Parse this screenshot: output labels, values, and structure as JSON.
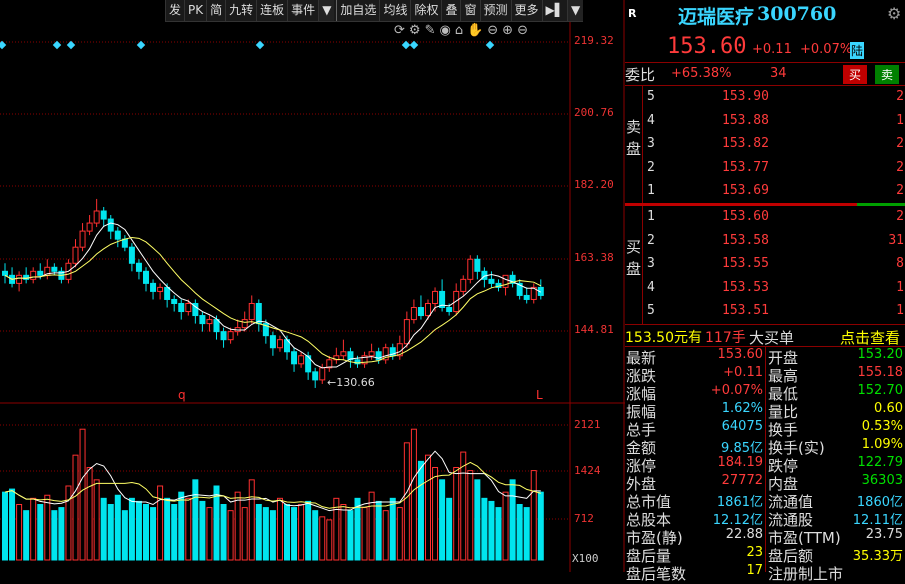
{
  "toolbar": {
    "items": [
      "发",
      "PK",
      "简",
      "九转",
      "连板",
      "事件",
      "▼",
      "加自选",
      "均线",
      "除权",
      "叠",
      "窗",
      "预测",
      "更多",
      "▶▌",
      "▼"
    ]
  },
  "chart": {
    "price_axis": [
      "219.32",
      "200.76",
      "182.20",
      "163.38",
      "144.81"
    ],
    "volume_axis": [
      "2121",
      "1424",
      "712",
      "X100"
    ],
    "low_marker": "←130.66",
    "marker_q": "q",
    "marker_l": "L",
    "colors": {
      "up": "#ff3030",
      "down": "#00e5ee",
      "ma5": "#ffffff",
      "ma10": "#ffff66",
      "grid": "#8b0000"
    }
  },
  "chart_data": {
    "type": "candlestick",
    "ylim": [
      128,
      222
    ],
    "candles": [
      [
        160,
        159,
        162,
        157
      ],
      [
        159,
        157,
        161,
        156
      ],
      [
        157,
        159,
        160,
        155
      ],
      [
        159,
        158,
        161,
        157
      ],
      [
        158,
        160,
        161,
        157
      ],
      [
        160,
        159,
        162,
        158
      ],
      [
        159,
        161,
        163,
        158
      ],
      [
        161,
        160,
        162,
        159
      ],
      [
        160,
        158,
        161,
        157
      ],
      [
        158,
        162,
        163,
        157
      ],
      [
        162,
        166,
        168,
        161
      ],
      [
        166,
        170,
        172,
        165
      ],
      [
        170,
        172,
        174,
        169
      ],
      [
        172,
        175,
        178,
        171
      ],
      [
        175,
        173,
        176,
        171
      ],
      [
        173,
        170,
        174,
        168
      ],
      [
        170,
        168,
        171,
        166
      ],
      [
        168,
        166,
        169,
        165
      ],
      [
        166,
        162,
        167,
        160
      ],
      [
        162,
        160,
        163,
        158
      ],
      [
        160,
        157,
        161,
        155
      ],
      [
        157,
        155,
        158,
        153
      ],
      [
        155,
        156,
        157,
        153
      ],
      [
        156,
        153,
        157,
        151
      ],
      [
        153,
        152,
        154,
        150
      ],
      [
        152,
        150,
        153,
        148
      ],
      [
        150,
        152,
        153,
        149
      ],
      [
        152,
        149,
        153,
        147
      ],
      [
        149,
        147,
        150,
        145
      ],
      [
        147,
        148,
        149,
        145
      ],
      [
        148,
        145,
        149,
        143
      ],
      [
        145,
        143,
        146,
        141
      ],
      [
        143,
        145,
        146,
        142
      ],
      [
        145,
        146,
        148,
        144
      ],
      [
        146,
        148,
        150,
        145
      ],
      [
        148,
        152,
        154,
        147
      ],
      [
        152,
        147,
        153,
        145
      ],
      [
        147,
        144,
        148,
        142
      ],
      [
        144,
        141,
        145,
        139
      ],
      [
        141,
        143,
        144,
        140
      ],
      [
        143,
        140,
        144,
        138
      ],
      [
        140,
        137,
        141,
        135
      ],
      [
        137,
        139,
        140,
        136
      ],
      [
        139,
        135,
        140,
        133
      ],
      [
        135,
        133,
        136,
        131
      ],
      [
        133,
        136,
        137,
        132
      ],
      [
        136,
        138,
        139,
        135
      ],
      [
        138,
        139,
        141,
        137
      ],
      [
        139,
        140,
        143,
        138
      ],
      [
        140,
        138,
        141,
        136
      ],
      [
        138,
        137,
        139,
        136
      ],
      [
        137,
        139,
        140,
        136
      ],
      [
        139,
        140,
        142,
        138
      ],
      [
        140,
        138,
        141,
        137
      ],
      [
        138,
        141,
        142,
        137
      ],
      [
        141,
        139,
        142,
        138
      ],
      [
        139,
        142,
        144,
        138
      ],
      [
        142,
        148,
        150,
        141
      ],
      [
        148,
        151,
        153,
        147
      ],
      [
        151,
        149,
        154,
        148
      ],
      [
        149,
        152,
        153,
        148
      ],
      [
        152,
        155,
        156,
        150
      ],
      [
        155,
        151,
        158,
        150
      ],
      [
        151,
        150,
        152,
        149
      ],
      [
        150,
        155,
        157,
        149
      ],
      [
        155,
        158,
        159,
        154
      ],
      [
        158,
        163,
        164,
        157
      ],
      [
        163,
        160,
        164,
        158
      ],
      [
        160,
        158,
        161,
        156
      ],
      [
        158,
        157,
        160,
        156
      ],
      [
        157,
        156,
        158,
        155
      ],
      [
        156,
        159,
        159,
        154
      ],
      [
        159,
        157,
        160,
        156
      ],
      [
        157,
        154,
        158,
        153
      ],
      [
        154,
        153,
        156,
        152
      ],
      [
        153,
        156,
        157,
        152
      ],
      [
        156,
        154,
        158,
        153
      ]
    ],
    "volumes": [
      1100,
      1150,
      900,
      800,
      1000,
      900,
      1050,
      800,
      850,
      1200,
      1700,
      2121,
      1500,
      1300,
      1000,
      900,
      1050,
      800,
      1000,
      950,
      900,
      850,
      1200,
      1000,
      900,
      1100,
      1000,
      1300,
      950,
      850,
      1200,
      900,
      800,
      1100,
      850,
      1300,
      900,
      850,
      800,
      1000,
      900,
      850,
      900,
      950,
      800,
      700,
      650,
      1000,
      900,
      800,
      1000,
      850,
      1100,
      950,
      800,
      1000,
      850,
      1900,
      2121,
      1600,
      1700,
      1500,
      1300,
      1000,
      1500,
      1750,
      1450,
      1300,
      1000,
      950,
      850,
      1100,
      1300,
      900,
      850,
      1450,
      1100
    ]
  },
  "panel": {
    "logo": "R",
    "name": "迈瑞医疗",
    "code": "300760",
    "price": "153.60",
    "change": "+0.11",
    "change_pct": "+0.07%",
    "tag": "陆",
    "weibi_label": "委比",
    "weibi_value": "+65.38%",
    "weicha_value": "34",
    "buy_btn": "买",
    "sell_btn": "卖",
    "sell_label": [
      "卖",
      "盘"
    ],
    "buy_label": [
      "买",
      "盘"
    ],
    "sell_rows": [
      {
        "lvl": "5",
        "price": "153.90",
        "vol": "2"
      },
      {
        "lvl": "4",
        "price": "153.88",
        "vol": "1"
      },
      {
        "lvl": "3",
        "price": "153.82",
        "vol": "2"
      },
      {
        "lvl": "2",
        "price": "153.77",
        "vol": "2"
      },
      {
        "lvl": "1",
        "price": "153.69",
        "vol": "2"
      }
    ],
    "buy_rows": [
      {
        "lvl": "1",
        "price": "153.60",
        "vol": "2"
      },
      {
        "lvl": "2",
        "price": "153.58",
        "vol": "31"
      },
      {
        "lvl": "3",
        "price": "153.55",
        "vol": "8"
      },
      {
        "lvl": "4",
        "price": "153.53",
        "vol": "1"
      },
      {
        "lvl": "5",
        "price": "153.51",
        "vol": "1"
      }
    ],
    "bigorder_price": "153.50元有",
    "bigorder_vol": "117手",
    "bigorder_type": "大买单",
    "bigorder_link": "点击查看",
    "stats": [
      {
        "l1": "最新",
        "v1": "153.60",
        "c1": "red",
        "l2": "开盘",
        "v2": "153.20",
        "c2": "grn"
      },
      {
        "l1": "涨跌",
        "v1": "+0.11",
        "c1": "red",
        "l2": "最高",
        "v2": "155.18",
        "c2": "red"
      },
      {
        "l1": "涨幅",
        "v1": "+0.07%",
        "c1": "red",
        "l2": "最低",
        "v2": "152.70",
        "c2": "grn"
      },
      {
        "l1": "振幅",
        "v1": "1.62%",
        "c1": "cyan",
        "l2": "量比",
        "v2": "0.60",
        "c2": "yel"
      },
      {
        "l1": "总手",
        "v1": "64075",
        "c1": "cyan",
        "l2": "换手",
        "v2": "0.53%",
        "c2": "yel"
      },
      {
        "l1": "金额",
        "v1": "9.85亿",
        "c1": "cyan",
        "l2": "换手(实)",
        "v2": "1.09%",
        "c2": "yel"
      },
      {
        "l1": "涨停",
        "v1": "184.19",
        "c1": "red",
        "l2": "跌停",
        "v2": "122.79",
        "c2": "grn"
      },
      {
        "l1": "外盘",
        "v1": "27772",
        "c1": "red",
        "l2": "内盘",
        "v2": "36303",
        "c2": "grn"
      },
      {
        "l1": "总市值",
        "v1": "1861亿",
        "c1": "cyan",
        "l2": "流通值",
        "v2": "1860亿",
        "c2": "cyan"
      },
      {
        "l1": "总股本",
        "v1": "12.12亿",
        "c1": "cyan",
        "l2": "流通股",
        "v2": "12.11亿",
        "c2": "cyan"
      },
      {
        "l1": "市盈(静)",
        "v1": "22.88",
        "c1": "wht",
        "l2": "市盈(TTM)",
        "v2": "23.75",
        "c2": "wht"
      },
      {
        "l1": "盘后量",
        "v1": "23",
        "c1": "yel",
        "l2": "盘后额",
        "v2": "35.33万",
        "c2": "yel"
      },
      {
        "l1": "盘后笔数",
        "v1": "17",
        "c1": "yel",
        "l2": "注册制上市",
        "v2": "",
        "c2": "wht"
      }
    ]
  }
}
